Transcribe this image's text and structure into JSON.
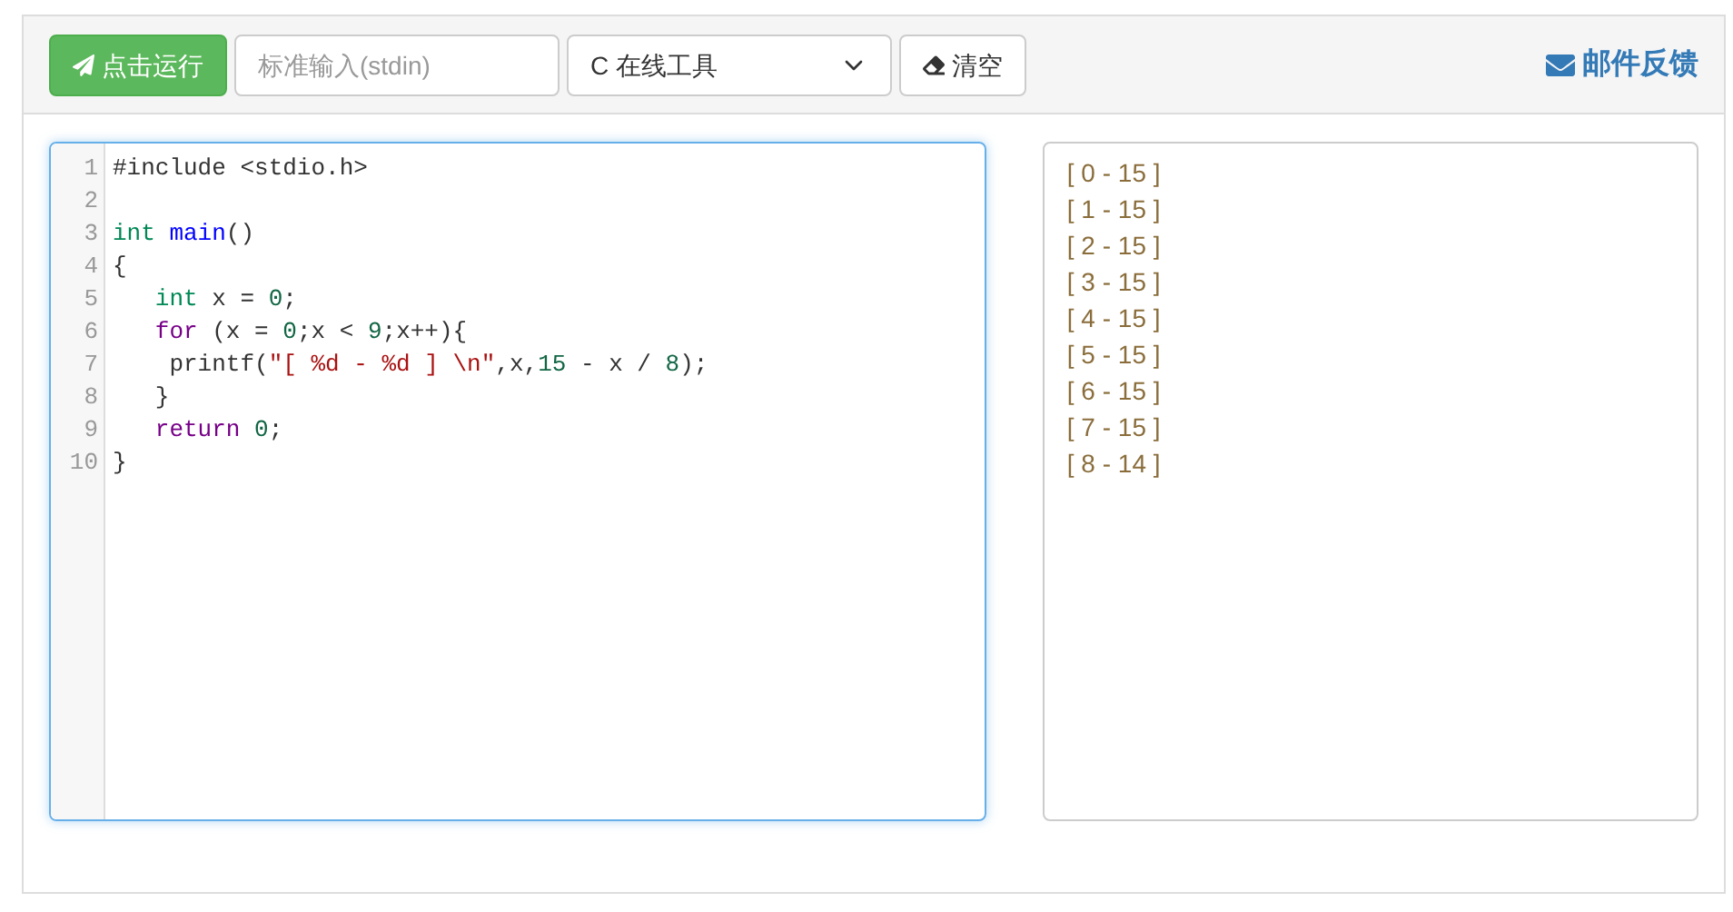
{
  "toolbar": {
    "run_button": "点击运行",
    "stdin": {
      "placeholder": "标准输入(stdin)"
    },
    "language_select": "C 在线工具",
    "clear_button": "清空",
    "feedback_link": "邮件反馈"
  },
  "editor": {
    "lines": [
      {
        "number": "1",
        "tokens": [
          {
            "kind": "plain",
            "text": "#include <stdio.h>"
          }
        ]
      },
      {
        "number": "2"
      },
      {
        "number": "3",
        "tokens": [
          {
            "kind": "type",
            "text": "int"
          },
          {
            "kind": "def",
            "text": " main"
          },
          {
            "kind": "plain",
            "text": "()"
          }
        ]
      },
      {
        "number": "4",
        "tokens": [
          {
            "kind": "plain",
            "text": "{"
          }
        ]
      },
      {
        "number": "5",
        "tokens": [
          {
            "kind": "type",
            "text": "   int"
          },
          {
            "kind": "plain",
            "text": " x = "
          },
          {
            "kind": "number",
            "text": "0"
          },
          {
            "kind": "plain",
            "text": ";"
          }
        ]
      },
      {
        "number": "6",
        "tokens": [
          {
            "kind": "keyword",
            "text": "   for"
          },
          {
            "kind": "plain",
            "text": " (x = "
          },
          {
            "kind": "number",
            "text": "0"
          },
          {
            "kind": "plain",
            "text": ";x < "
          },
          {
            "kind": "number",
            "text": "9"
          },
          {
            "kind": "plain",
            "text": ";x++){"
          }
        ]
      },
      {
        "number": "7",
        "tokens": [
          {
            "kind": "plain",
            "text": "    printf("
          },
          {
            "kind": "string",
            "text": "\"[ %d - %d ] \\n\""
          },
          {
            "kind": "plain",
            "text": ",x,"
          },
          {
            "kind": "number",
            "text": "15"
          },
          {
            "kind": "plain",
            "text": " - x / "
          },
          {
            "kind": "number",
            "text": "8"
          },
          {
            "kind": "plain",
            "text": ");"
          }
        ]
      },
      {
        "number": "8",
        "tokens": [
          {
            "kind": "plain",
            "text": "   }"
          }
        ]
      },
      {
        "number": "9",
        "tokens": [
          {
            "kind": "keyword",
            "text": "   return"
          },
          {
            "kind": "number",
            "text": " 0"
          },
          {
            "kind": "plain",
            "text": ";"
          }
        ]
      },
      {
        "number": "10",
        "tokens": [
          {
            "kind": "plain",
            "text": "}"
          }
        ]
      }
    ]
  },
  "output": [
    "[ 0 - 15 ]",
    "[ 1 - 15 ]",
    "[ 2 - 15 ]",
    "[ 3 - 15 ]",
    "[ 4 - 15 ]",
    "[ 5 - 15 ]",
    "[ 6 - 15 ]",
    "[ 7 - 15 ]",
    "[ 8 - 14 ]"
  ]
}
